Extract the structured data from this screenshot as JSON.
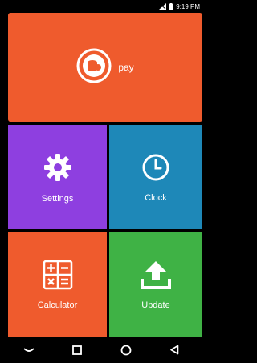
{
  "status_bar": {
    "time": "9:19 PM",
    "icons": [
      "no-sim-icon",
      "battery-icon"
    ]
  },
  "tiles": {
    "pay": {
      "label": "pay",
      "icon": "pay-logo-icon",
      "color": "#ef5b2d"
    },
    "settings": {
      "label": "Settings",
      "icon": "gear-icon",
      "color": "#8e3fe0"
    },
    "clock": {
      "label": "Clock",
      "icon": "clock-icon",
      "color": "#1e88b8"
    },
    "calculator": {
      "label": "Calculator",
      "icon": "calculator-icon",
      "color": "#ef5b2d"
    },
    "update": {
      "label": "Update",
      "icon": "upload-icon",
      "color": "#3fb245"
    }
  },
  "nav_bar": {
    "buttons": [
      "collapse-icon",
      "recent-apps-icon",
      "home-icon",
      "back-icon"
    ]
  }
}
